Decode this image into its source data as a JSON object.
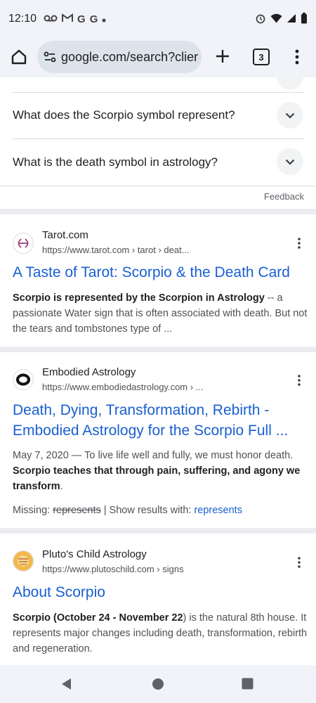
{
  "status_bar": {
    "time": "12:10",
    "left_icons": [
      "voicemail-icon",
      "gmail-icon",
      "google-icon",
      "google-icon",
      "dot-icon"
    ],
    "right_icons": [
      "alarm-icon",
      "wifi-icon",
      "signal-icon",
      "battery-icon"
    ]
  },
  "toolbar": {
    "url": "google.com/search?clier",
    "tab_count": "3"
  },
  "faq": [
    {
      "question": "What does the Scorpio symbol represent?"
    },
    {
      "question": "What is the death symbol in astrology?"
    }
  ],
  "feedback_label": "Feedback",
  "results": [
    {
      "site_name": "Tarot.com",
      "url": "https://www.tarot.com › tarot › deat...",
      "title": "A Taste of Tarot: Scorpio & the Death Card",
      "snippet_bold": "Scorpio is represented by the Scorpion in Astrology",
      "snippet_rest": " -- a passionate Water sign that is often associated with death. But not the tears and tombstones type of ..."
    },
    {
      "site_name": "Embodied Astrology",
      "url": "https://www.embodiedastrology.com › ...",
      "title": "Death, Dying, Transformation, Rebirth - Embodied Astrology for the Scorpio Full ...",
      "snippet_plain": "May 7, 2020 — To live life well and fully, we must honor death. ",
      "snippet_bold": "Scorpio teaches that through pain, suffering, and agony we transform",
      "snippet_end": ".",
      "missing_label": "Missing: ",
      "missing_word": "represents",
      "show_results_label": " | Show results with: ",
      "show_results_link": "represents"
    },
    {
      "site_name": "Pluto's Child Astrology",
      "url": "https://www.plutoschild.com › signs",
      "title": "About Scorpio",
      "snippet_bold": "Scorpio (October 24 - November 22",
      "snippet_rest": ") is the natural 8th house. It represents major changes including death, transformation, rebirth and regeneration."
    }
  ]
}
